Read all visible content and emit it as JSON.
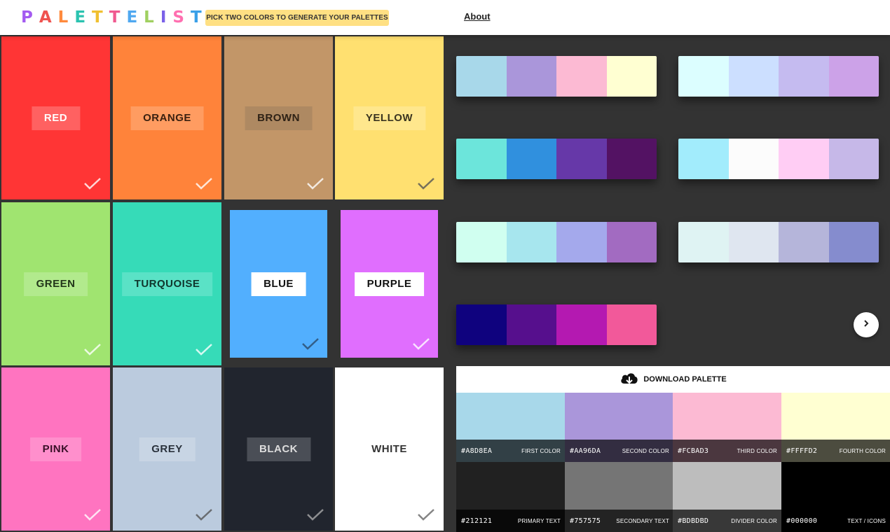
{
  "header": {
    "logo_letters": [
      {
        "ch": "P",
        "color": "#a45bf0"
      },
      {
        "ch": "A",
        "color": "#ef5350"
      },
      {
        "ch": "L",
        "color": "#ff8a3d"
      },
      {
        "ch": "E",
        "color": "#2bc3b0"
      },
      {
        "ch": "T",
        "color": "#f0c030"
      },
      {
        "ch": "T",
        "color": "#f05a90"
      },
      {
        "ch": "E",
        "color": "#4fa8f0"
      },
      {
        "ch": "L",
        "color": "#a0d060"
      },
      {
        "ch": "I",
        "color": "#7b61e8"
      },
      {
        "ch": "S",
        "color": "#ff6fb0"
      },
      {
        "ch": "T",
        "color": "#3aa0e8"
      }
    ],
    "hint": "PICK TWO COLORS TO GENERATE YOUR PALETTES",
    "about": "About"
  },
  "colors": [
    {
      "label": "RED",
      "bg": "#ff3535",
      "label_bg": "#ff6161",
      "label_color": "#ffffff",
      "check_color": "#ffffff",
      "selected": false
    },
    {
      "label": "ORANGE",
      "bg": "#ff833a",
      "label_bg": "#ff9c61",
      "label_color": "#3a2010",
      "check_color": "#ffffff",
      "selected": false
    },
    {
      "label": "BROWN",
      "bg": "#c29668",
      "label_bg": "#ae8962",
      "label_color": "#2e2216",
      "check_color": "#ffffff",
      "selected": false
    },
    {
      "label": "YELLOW",
      "bg": "#ffe070",
      "label_bg": "#ffe78d",
      "label_color": "#3a3420",
      "check_color": "#555555",
      "selected": false
    },
    {
      "label": "GREEN",
      "bg": "#a0e470",
      "label_bg": "#b2ea8d",
      "label_color": "#22361a",
      "check_color": "#ffffff",
      "selected": false
    },
    {
      "label": "TURQUOISE",
      "bg": "#36dbb8",
      "label_bg": "#5ae2c6",
      "label_color": "#10352c",
      "check_color": "#ffffff",
      "selected": false
    },
    {
      "label": "BLUE",
      "bg": "#52affe",
      "label_bg": "#ffffff",
      "label_color": "#111111",
      "check_color": "#2a4a6a",
      "selected": true
    },
    {
      "label": "PURPLE",
      "bg": "#e06efe",
      "label_bg": "#ffffff",
      "label_color": "#111111",
      "check_color": "#ffffff",
      "selected": true
    },
    {
      "label": "PINK",
      "bg": "#ff74c0",
      "label_bg": "#ff8fcc",
      "label_color": "#3a1028",
      "check_color": "#ffffff",
      "selected": false
    },
    {
      "label": "GREY",
      "bg": "#bbcbde",
      "label_bg": "#c8d5e4",
      "label_color": "#2a323c",
      "check_color": "#555555",
      "selected": false
    },
    {
      "label": "BLACK",
      "bg": "#21252e",
      "label_bg": "#4a4e56",
      "label_color": "#dddddd",
      "check_color": "#aaaaaa",
      "selected": false
    },
    {
      "label": "WHITE",
      "bg": "#ffffff",
      "label_bg": "#ffffff",
      "label_color": "#333333",
      "check_color": "#666666",
      "selected": false
    }
  ],
  "palettes": [
    [
      "#a8d8ea",
      "#aa96da",
      "#fcbad3",
      "#ffffd2"
    ],
    [
      "#dcfeff",
      "#ccdfff",
      "#c5bbf0",
      "#cca2e8"
    ],
    [
      "#6ce5db",
      "#3090de",
      "#6638a8",
      "#531263"
    ],
    [
      "#a2ecfc",
      "#fcfcfc",
      "#ffcdf4",
      "#c6b8e8"
    ],
    [
      "#d0fff0",
      "#a7e6ee",
      "#a4a9ec",
      "#a26bc1"
    ],
    [
      "#dff3f3",
      "#dfe6f0",
      "#b5b5da",
      "#858cce"
    ],
    [
      "#0f027e",
      "#560f8d",
      "#b419b1",
      "#f2599a"
    ]
  ],
  "download": {
    "label": "DOWNLOAD PALETTE"
  },
  "detail": {
    "top": [
      {
        "hex": "#A8D8EA",
        "name": "FIRST COLOR",
        "color": "#a8d8ea"
      },
      {
        "hex": "#AA96DA",
        "name": "SECOND COLOR",
        "color": "#aa96da"
      },
      {
        "hex": "#FCBAD3",
        "name": "THIRD COLOR",
        "color": "#fcbad3"
      },
      {
        "hex": "#FFFFD2",
        "name": "FOURTH COLOR",
        "color": "#ffffd2"
      }
    ],
    "bottom": [
      {
        "hex": "#212121",
        "name": "PRIMARY TEXT",
        "color": "#212121"
      },
      {
        "hex": "#757575",
        "name": "SECONDARY TEXT",
        "color": "#757575"
      },
      {
        "hex": "#BDBDBD",
        "name": "DIVIDER COLOR",
        "color": "#bdbdbd"
      },
      {
        "hex": "#000000",
        "name": "TEXT / ICONS",
        "color": "#000000"
      }
    ]
  }
}
